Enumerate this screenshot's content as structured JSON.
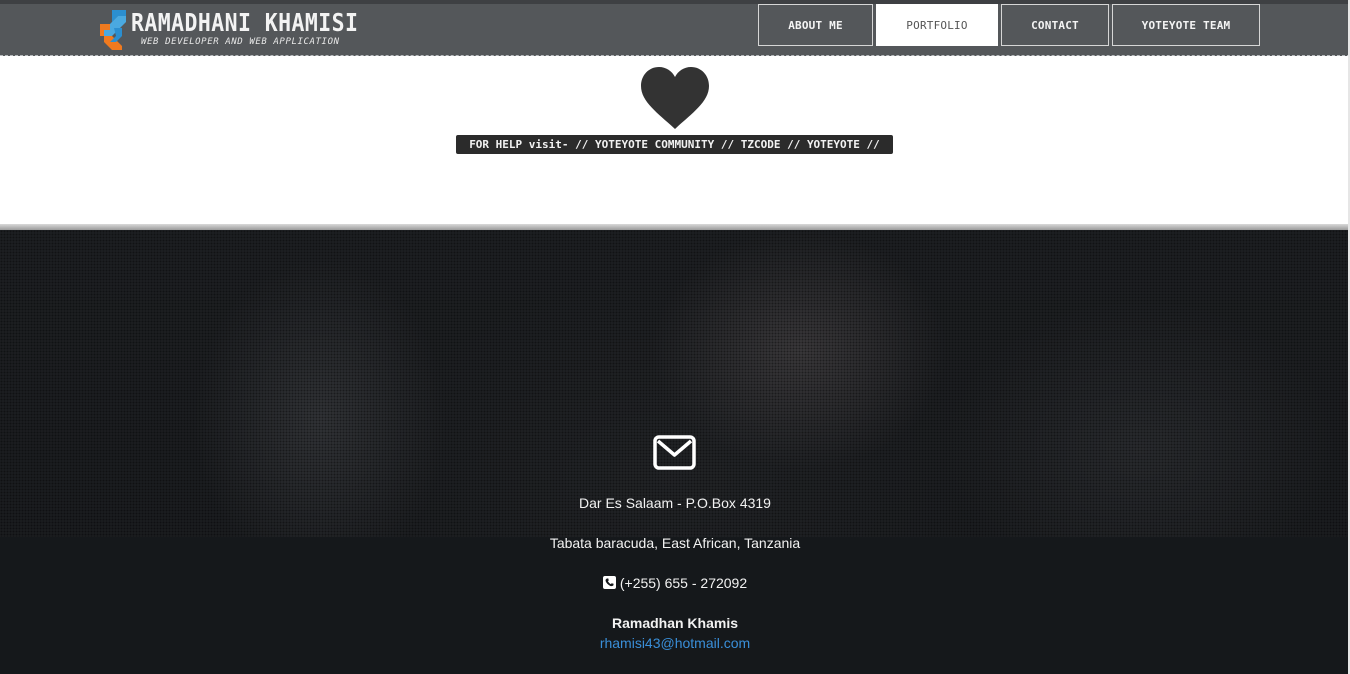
{
  "header": {
    "logo_name": "RAMADHANI KHAMISI",
    "logo_tagline": "WEB DEVELOPER AND WEB APPLICATION",
    "nav": [
      {
        "label": "ABOUT ME",
        "active": false
      },
      {
        "label": "PORTFOLIO",
        "active": true
      },
      {
        "label": "CONTACT",
        "active": false
      },
      {
        "label": "YOTEYOTE TEAM",
        "active": false
      }
    ]
  },
  "banner": {
    "icon": "heart-icon",
    "help_text": "FOR HELP visit- // YOTEYOTE COMMUNITY // TZCODE // YOTEYOTE //"
  },
  "footer": {
    "icon": "envelope-icon",
    "address_line1": "Dar Es Salaam - P.O.Box 4319",
    "address_line2": "Tabata baracuda, East African, Tanzania",
    "phone_icon": "phone-square-icon",
    "phone": "(+255) 655 - 272092",
    "name": "Ramadhan Khamis",
    "email": "rhamisi43@hotmail.com"
  },
  "colors": {
    "header_bg": "#54575a",
    "footer_bg": "#15181b",
    "link": "#3a8fd9",
    "logo_orange": "#f07a1f",
    "logo_blue": "#2b8fd0"
  }
}
